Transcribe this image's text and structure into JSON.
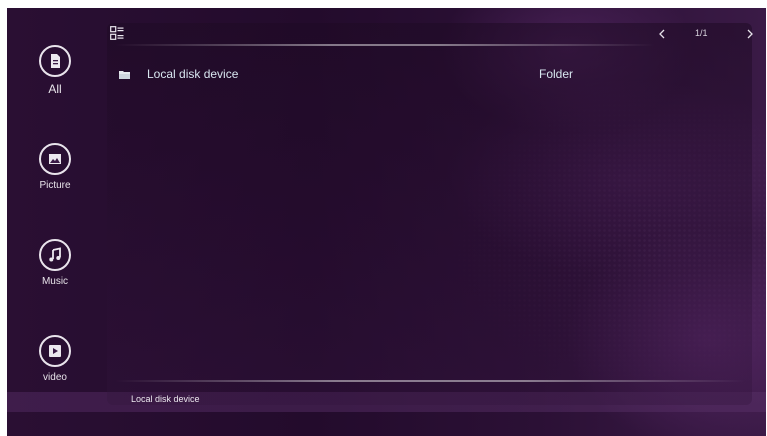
{
  "sidebar": {
    "items": [
      {
        "label": "All",
        "icon": "document-icon"
      },
      {
        "label": "Picture",
        "icon": "image-icon"
      },
      {
        "label": "Music",
        "icon": "music-note-icon"
      },
      {
        "label": "video",
        "icon": "play-icon"
      }
    ]
  },
  "toolbar": {
    "view_icon": "list-view-icon",
    "pager": {
      "prev_icon": "chevron-left-icon",
      "text": "1/1",
      "next_icon": "chevron-right-icon"
    }
  },
  "files": [
    {
      "name": "Local disk device",
      "type": "Folder",
      "icon": "folder-icon"
    }
  ],
  "status": {
    "path": "Local disk device"
  },
  "colors": {
    "background": "#2a0f33",
    "text": "#d8e7f0",
    "accent": "#e9e4ec"
  }
}
